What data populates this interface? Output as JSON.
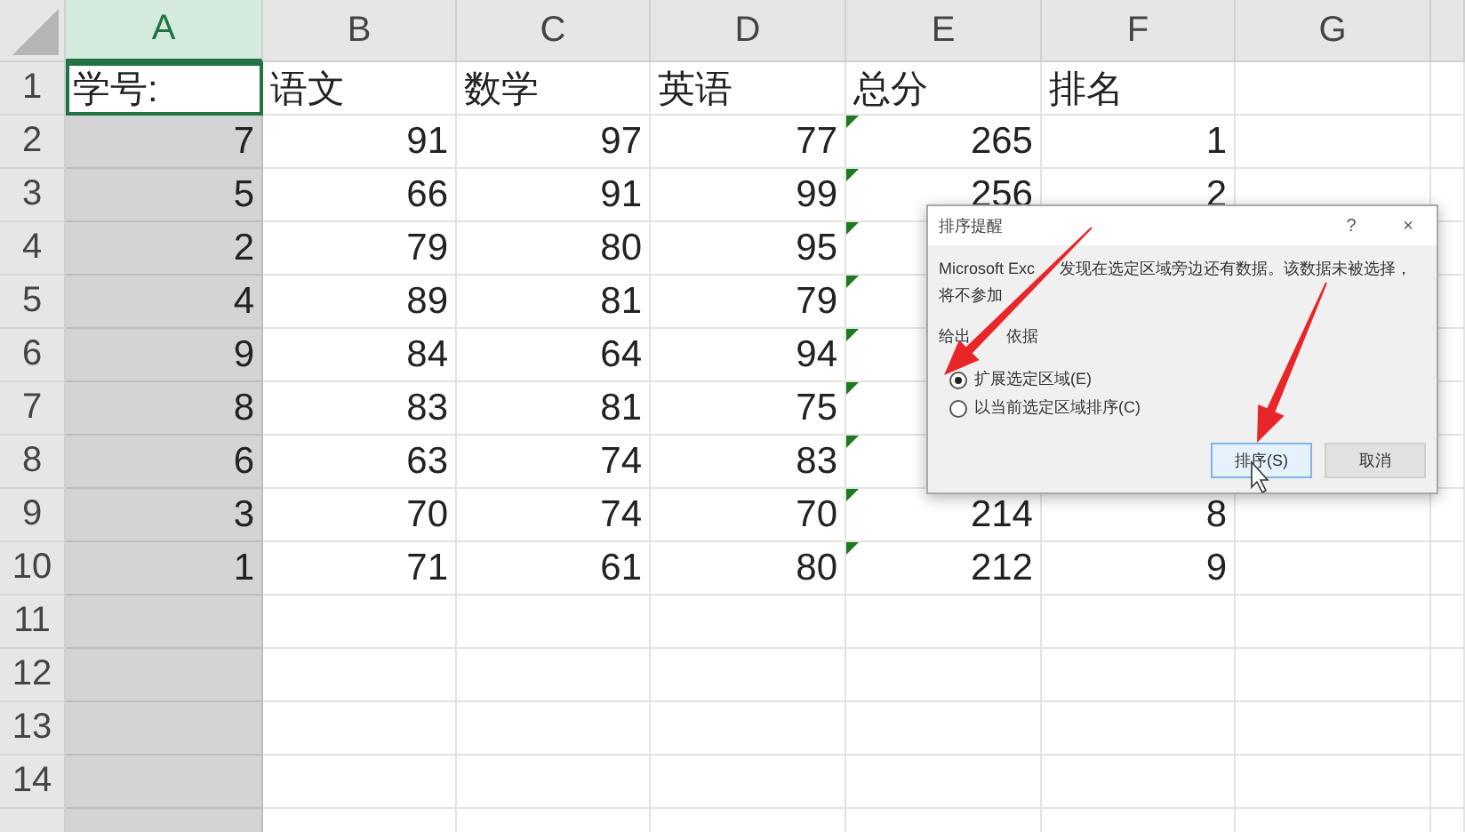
{
  "columns": [
    {
      "label": "A",
      "selected": true
    },
    {
      "label": "B",
      "selected": false
    },
    {
      "label": "C",
      "selected": false
    },
    {
      "label": "D",
      "selected": false
    },
    {
      "label": "E",
      "selected": false
    },
    {
      "label": "F",
      "selected": false
    },
    {
      "label": "G",
      "selected": false
    }
  ],
  "rows": [
    {
      "number": "1",
      "marked": false,
      "cells": [
        {
          "text": "学号:",
          "kind": "text"
        },
        {
          "text": "语文",
          "kind": "text"
        },
        {
          "text": "数学",
          "kind": "text"
        },
        {
          "text": "英语",
          "kind": "text"
        },
        {
          "text": "总分",
          "kind": "text"
        },
        {
          "text": "排名",
          "kind": "text"
        }
      ]
    },
    {
      "number": "2",
      "marked": true,
      "cells": [
        {
          "text": "7",
          "kind": "number"
        },
        {
          "text": "91",
          "kind": "number"
        },
        {
          "text": "97",
          "kind": "number"
        },
        {
          "text": "77",
          "kind": "number"
        },
        {
          "text": "265",
          "kind": "number"
        },
        {
          "text": "1",
          "kind": "number"
        }
      ]
    },
    {
      "number": "3",
      "marked": true,
      "cells": [
        {
          "text": "5",
          "kind": "number"
        },
        {
          "text": "66",
          "kind": "number"
        },
        {
          "text": "91",
          "kind": "number"
        },
        {
          "text": "99",
          "kind": "number"
        },
        {
          "text": "256",
          "kind": "number"
        },
        {
          "text": "2",
          "kind": "number"
        }
      ]
    },
    {
      "number": "4",
      "marked": true,
      "cells": [
        {
          "text": "2",
          "kind": "number"
        },
        {
          "text": "79",
          "kind": "number"
        },
        {
          "text": "80",
          "kind": "number"
        },
        {
          "text": "95",
          "kind": "number"
        }
      ]
    },
    {
      "number": "5",
      "marked": true,
      "cells": [
        {
          "text": "4",
          "kind": "number"
        },
        {
          "text": "89",
          "kind": "number"
        },
        {
          "text": "81",
          "kind": "number"
        },
        {
          "text": "79",
          "kind": "number"
        }
      ]
    },
    {
      "number": "6",
      "marked": true,
      "cells": [
        {
          "text": "9",
          "kind": "number"
        },
        {
          "text": "84",
          "kind": "number"
        },
        {
          "text": "64",
          "kind": "number"
        },
        {
          "text": "94",
          "kind": "number"
        }
      ]
    },
    {
      "number": "7",
      "marked": true,
      "cells": [
        {
          "text": "8",
          "kind": "number"
        },
        {
          "text": "83",
          "kind": "number"
        },
        {
          "text": "81",
          "kind": "number"
        },
        {
          "text": "75",
          "kind": "number"
        }
      ]
    },
    {
      "number": "8",
      "marked": true,
      "cells": [
        {
          "text": "6",
          "kind": "number"
        },
        {
          "text": "63",
          "kind": "number"
        },
        {
          "text": "74",
          "kind": "number"
        },
        {
          "text": "83",
          "kind": "number"
        }
      ]
    },
    {
      "number": "9",
      "marked": true,
      "cells": [
        {
          "text": "3",
          "kind": "number"
        },
        {
          "text": "70",
          "kind": "number"
        },
        {
          "text": "74",
          "kind": "number"
        },
        {
          "text": "70",
          "kind": "number"
        },
        {
          "text": "214",
          "kind": "number"
        },
        {
          "text": "8",
          "kind": "number"
        }
      ]
    },
    {
      "number": "10",
      "marked": true,
      "cells": [
        {
          "text": "1",
          "kind": "number"
        },
        {
          "text": "71",
          "kind": "number"
        },
        {
          "text": "61",
          "kind": "number"
        },
        {
          "text": "80",
          "kind": "number"
        },
        {
          "text": "212",
          "kind": "number"
        },
        {
          "text": "9",
          "kind": "number"
        }
      ]
    },
    {
      "number": "11",
      "marked": false,
      "cells": []
    },
    {
      "number": "12",
      "marked": false,
      "cells": []
    },
    {
      "number": "13",
      "marked": false,
      "cells": []
    },
    {
      "number": "14",
      "marked": false,
      "cells": []
    }
  ],
  "dialog": {
    "title": "排序提醒",
    "help": "?",
    "close": "×",
    "message_lines": [
      [
        "Microsoft Exc",
        "发现在选定区域旁边还有数据。该数据未被选择，"
      ],
      [
        "将不参加"
      ]
    ],
    "group_label": [
      "给出",
      "依据"
    ],
    "options": [
      {
        "label": "扩展选定区域(E)",
        "selected": true
      },
      {
        "label": "以当前选定区域排序(C)",
        "selected": false
      }
    ],
    "buttons": [
      {
        "label": "排序(S)",
        "kind": "primary"
      },
      {
        "label": "取消",
        "kind": "secondary"
      }
    ]
  }
}
